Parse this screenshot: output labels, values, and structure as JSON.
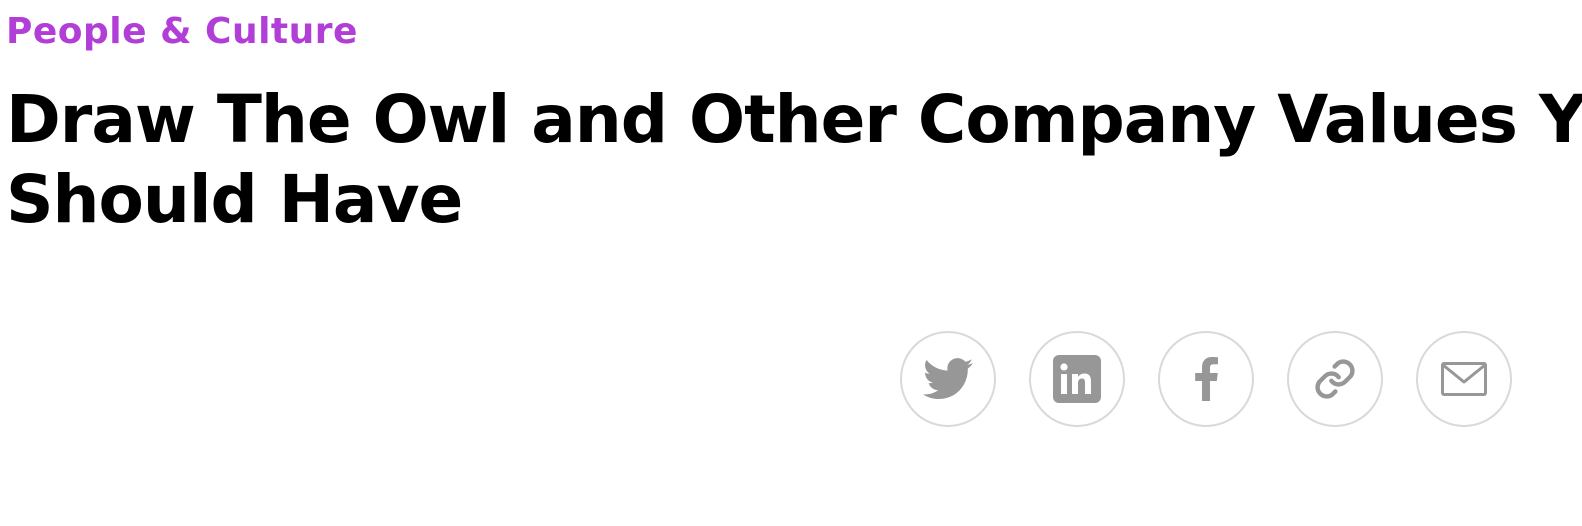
{
  "article": {
    "category": "People & Culture",
    "title": "Draw The Owl and Other Company Values You Should Have"
  },
  "share": {
    "icon_color": "#979797",
    "border_color": "#d9d9d9",
    "buttons": [
      {
        "icon": "twitter-icon"
      },
      {
        "icon": "linkedin-icon"
      },
      {
        "icon": "facebook-icon"
      },
      {
        "icon": "link-icon"
      },
      {
        "icon": "email-icon"
      }
    ]
  },
  "colors": {
    "category": "#b23ed8",
    "title": "#000000",
    "background": "#ffffff"
  }
}
